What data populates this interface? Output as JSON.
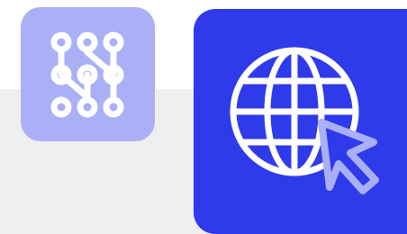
{
  "apps": [
    {
      "id": "workflow-app",
      "icon": "node-network-icon",
      "tile_color": "#aab0f6",
      "glyph_color": "#ffffff"
    },
    {
      "id": "web-browser-app",
      "icon": "globe-cursor-icon",
      "tile_color": "#2f3bea",
      "glyph_color": "#ffffff",
      "cursor_stroke_color": "#aab0f6"
    }
  ]
}
